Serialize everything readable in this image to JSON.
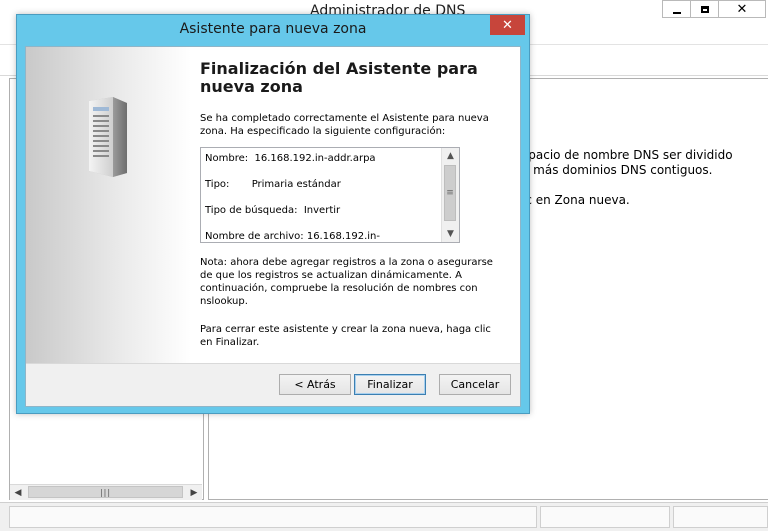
{
  "background_window": {
    "title": "Administrador de DNS",
    "right_pane_text": {
      "line1": "spacio de nombre DNS ser dividido",
      "line2": "o más dominios DNS contiguos.",
      "line3": "ic en Zona nueva."
    },
    "left_fragment_1": "<",
    "left_fragment_2": "^"
  },
  "wizard": {
    "title": "Asistente para nueva zona",
    "heading": "Finalización del Asistente para nueva zona",
    "intro": "Se ha completado correctamente el Asistente para nueva zona. Ha especificado la siguiente configuración:",
    "summary": {
      "name_label": "Nombre:",
      "name_value": "16.168.192.in-addr.arpa",
      "type_label": "Tipo:",
      "type_value": "Primaria estándar",
      "lookup_label": "Tipo de búsqueda:",
      "lookup_value": "Invertir",
      "file_label": "Nombre de archivo:",
      "file_value": "16.168.192.in-"
    },
    "note": "Nota: ahora debe agregar registros a la zona o asegurarse de que los registros se actualizan dinámicamente. A continuación, compruebe la resolución de nombres con nslookup.",
    "close_hint": "Para cerrar este asistente y crear la zona nueva, haga clic en Finalizar.",
    "buttons": {
      "back": "< Atrás",
      "finish": "Finalizar",
      "cancel": "Cancelar"
    }
  },
  "icons": {
    "server": "server-icon",
    "close": "close-icon",
    "minimize": "minimize-icon",
    "maximize": "maximize-icon"
  },
  "colors": {
    "wizard_frame": "#66c8ea",
    "close_button": "#c7453b"
  }
}
